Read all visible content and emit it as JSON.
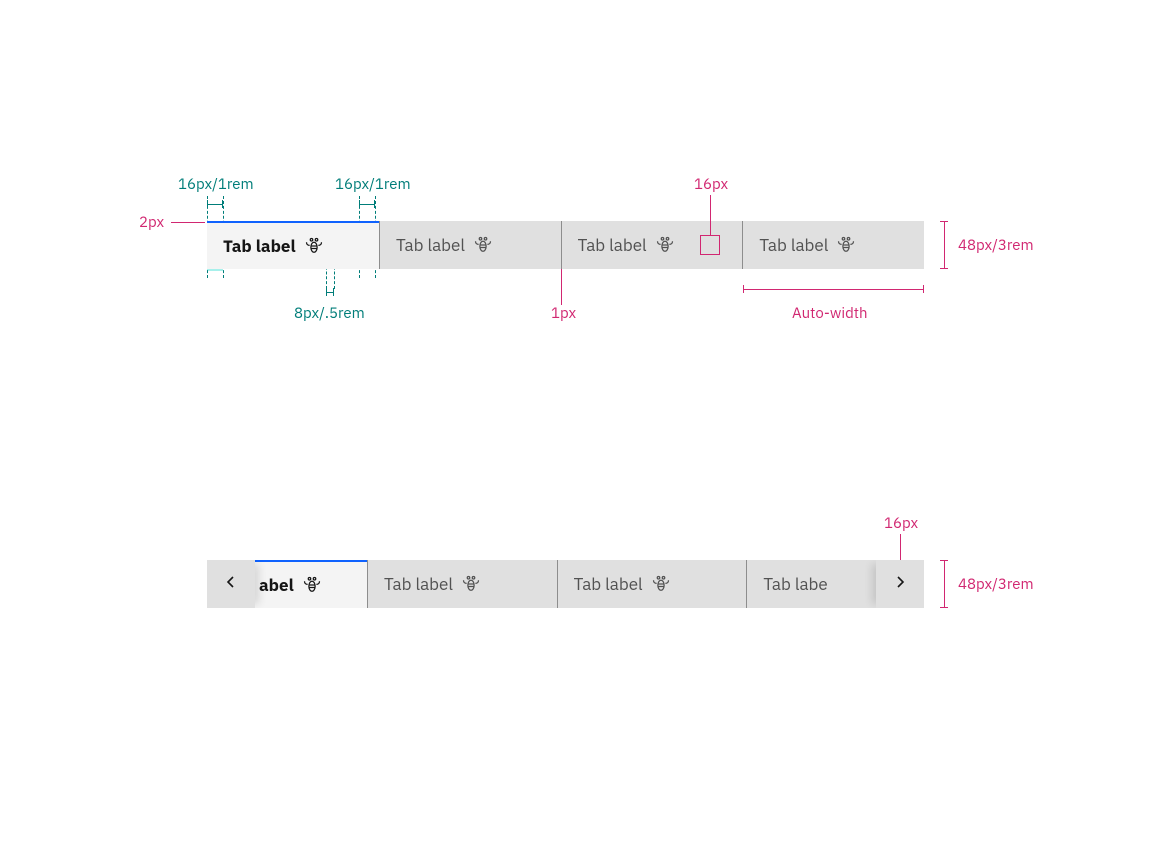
{
  "annotations": {
    "pad_left": "16px/1rem",
    "pad_right": "16px/1rem",
    "gap": "8px/.5rem",
    "border_top": "2px",
    "divider": "1px",
    "auto_width": "Auto-width",
    "icon_size": "16px",
    "height": "48px/3rem"
  },
  "spec1": {
    "tabs": [
      {
        "label": "Tab label",
        "selected": true
      },
      {
        "label": "Tab label",
        "selected": false
      },
      {
        "label": "Tab label",
        "selected": false
      },
      {
        "label": "Tab label",
        "selected": false
      }
    ]
  },
  "spec2": {
    "tabs": [
      {
        "label": "abel",
        "selected": true,
        "cut": "left"
      },
      {
        "label": "Tab label",
        "selected": false
      },
      {
        "label": "Tab label",
        "selected": false
      },
      {
        "label": "Tab labe",
        "selected": false,
        "cut": "right"
      }
    ]
  }
}
